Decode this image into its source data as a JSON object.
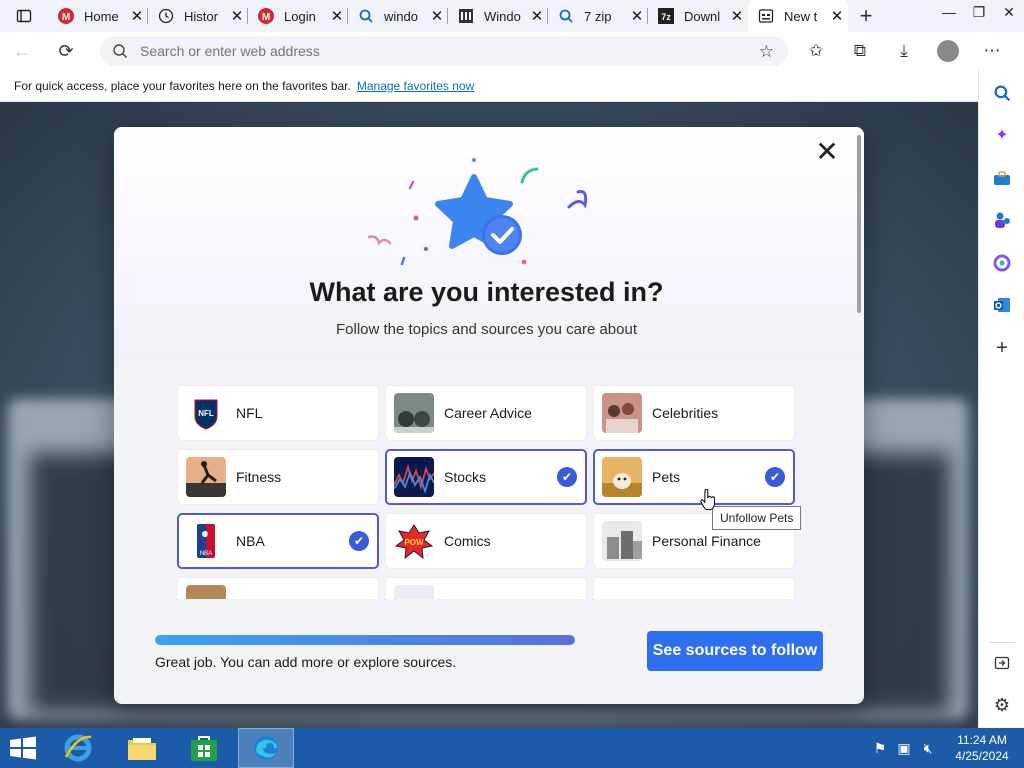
{
  "browser": {
    "tabs": [
      {
        "title": "Home",
        "favicon": "mega-icon"
      },
      {
        "title": "Histor",
        "favicon": "history-icon"
      },
      {
        "title": "Login",
        "favicon": "mega-icon"
      },
      {
        "title": "windo",
        "favicon": "search-icon"
      },
      {
        "title": "Windo",
        "favicon": "building-icon"
      },
      {
        "title": "7 zip",
        "favicon": "search-icon"
      },
      {
        "title": "Downl",
        "favicon": "7zip-icon"
      },
      {
        "title": "New t",
        "favicon": "newtab-icon",
        "active": true
      }
    ],
    "address_placeholder": "Search or enter web address",
    "favorites_bar": {
      "text": "For quick access, place your favorites here on the favorites bar.",
      "link": "Manage favorites now"
    }
  },
  "dialog": {
    "title": "What are you interested in?",
    "subtitle": "Follow the topics and sources you care about",
    "topics": [
      {
        "label": "NFL",
        "selected": false
      },
      {
        "label": "Career Advice",
        "selected": false
      },
      {
        "label": "Celebrities",
        "selected": false
      },
      {
        "label": "Fitness",
        "selected": false
      },
      {
        "label": "Stocks",
        "selected": true
      },
      {
        "label": "Pets",
        "selected": true
      },
      {
        "label": "NBA",
        "selected": true
      },
      {
        "label": "Comics",
        "selected": false
      },
      {
        "label": "Personal Finance",
        "selected": false
      }
    ],
    "tooltip": "Unfollow Pets",
    "progress_text": "Great job. You can add more or explore sources.",
    "progress_fraction": 1.0,
    "cta_label": "See sources to follow"
  },
  "taskbar": {
    "time": "11:24 AM",
    "date": "4/25/2024"
  },
  "colors": {
    "accent": "#2f6fed",
    "selected_border": "#4f5bd5",
    "taskbar": "#1c5ba7"
  }
}
